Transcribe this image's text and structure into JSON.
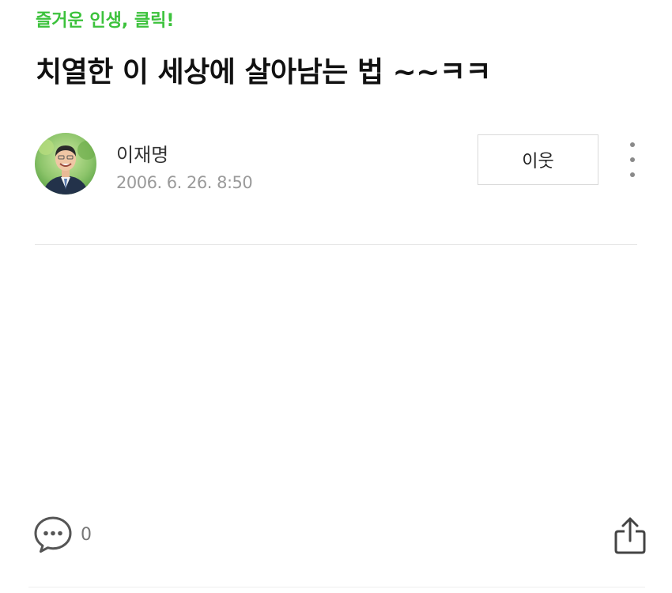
{
  "post": {
    "category": "즐거운 인생, 클릭!",
    "title": "치열한 이 세상에 살아남는 법 ~~ㅋㅋ"
  },
  "author": {
    "name": "이재명",
    "date": "2006. 6. 26. 8:50",
    "avatar_icon": "person-photo"
  },
  "actions": {
    "neighbor_label": "이웃",
    "more_icon": "vertical-ellipsis-icon",
    "comment_icon": "speech-bubble-icon",
    "comment_count": "0",
    "share_icon": "share-icon"
  },
  "colors": {
    "accent": "#3cc23c",
    "title": "#111111",
    "muted": "#9a9a9a"
  }
}
